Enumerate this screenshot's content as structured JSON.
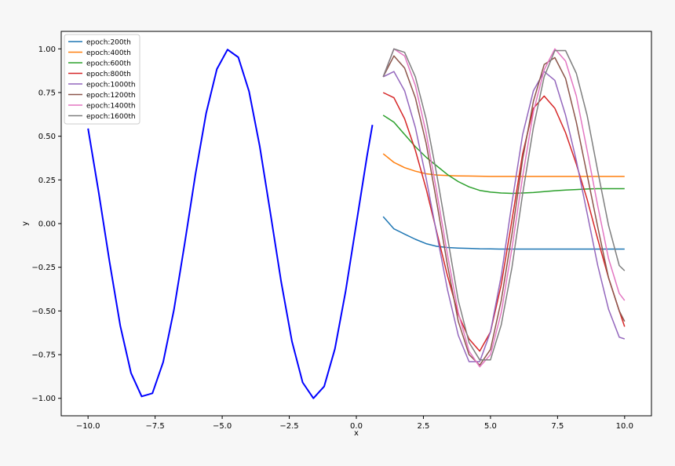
{
  "chart_data": {
    "type": "line",
    "title": "",
    "xlabel": "x",
    "ylabel": "y",
    "xlim": [
      -11.0,
      11.0
    ],
    "ylim": [
      -1.1,
      1.1
    ],
    "grid": false,
    "legend_position": "top-left",
    "x_ticks": [
      {
        "value": -10.0,
        "label": "−10.0"
      },
      {
        "value": -7.5,
        "label": "−7.5"
      },
      {
        "value": -5.0,
        "label": "−5.0"
      },
      {
        "value": -2.5,
        "label": "−2.5"
      },
      {
        "value": 0.0,
        "label": "0.0"
      },
      {
        "value": 2.5,
        "label": "2.5"
      },
      {
        "value": 5.0,
        "label": "5.0"
      },
      {
        "value": 7.5,
        "label": "7.5"
      },
      {
        "value": 10.0,
        "label": "10.0"
      }
    ],
    "y_ticks": [
      {
        "value": 1.0,
        "label": "1.00"
      },
      {
        "value": 0.75,
        "label": "0.75"
      },
      {
        "value": 0.5,
        "label": "0.50"
      },
      {
        "value": 0.25,
        "label": "0.25"
      },
      {
        "value": 0.0,
        "label": "0.00"
      },
      {
        "value": -0.25,
        "label": "−0.25"
      },
      {
        "value": -0.5,
        "label": "−0.50"
      },
      {
        "value": -0.75,
        "label": "−0.75"
      },
      {
        "value": -1.0,
        "label": "−1.00"
      }
    ],
    "x_left": [
      -10.0,
      -9.6,
      -9.2,
      -8.8,
      -8.4,
      -8.0,
      -7.6,
      -7.2,
      -6.8,
      -6.4,
      -6.0,
      -5.6,
      -5.2,
      -4.8,
      -4.4,
      -4.0,
      -3.6,
      -3.2,
      -2.8,
      -2.4,
      -2.0,
      -1.6,
      -1.2,
      -0.8,
      -0.4,
      0.0,
      0.4,
      0.6
    ],
    "x_right": [
      1.0,
      1.4,
      1.8,
      2.2,
      2.6,
      3.0,
      3.4,
      3.8,
      4.2,
      4.6,
      5.0,
      5.4,
      5.8,
      6.2,
      6.6,
      7.0,
      7.4,
      7.8,
      8.2,
      8.6,
      9.0,
      9.4,
      9.8,
      10.0
    ],
    "ground_truth": {
      "color": "#0000ff",
      "values": [
        0.544,
        0.174,
        -0.217,
        -0.584,
        -0.855,
        -0.989,
        -0.971,
        -0.793,
        -0.494,
        -0.117,
        0.279,
        0.631,
        0.884,
        0.996,
        0.952,
        0.757,
        0.443,
        0.058,
        -0.335,
        -0.675,
        -0.909,
        -1.0,
        -0.932,
        -0.717,
        -0.389,
        0.0,
        0.389,
        0.565
      ]
    },
    "series": [
      {
        "name": "epoch:200th",
        "color": "#1f77b4",
        "values": [
          0.04,
          -0.03,
          -0.06,
          -0.09,
          -0.115,
          -0.13,
          -0.137,
          -0.14,
          -0.142,
          -0.144,
          -0.145,
          -0.146,
          -0.146,
          -0.146,
          -0.146,
          -0.146,
          -0.146,
          -0.146,
          -0.146,
          -0.146,
          -0.146,
          -0.146,
          -0.146,
          -0.146
        ]
      },
      {
        "name": "epoch:400th",
        "color": "#ff7f0e",
        "values": [
          0.4,
          0.35,
          0.32,
          0.3,
          0.285,
          0.278,
          0.275,
          0.273,
          0.272,
          0.271,
          0.27,
          0.27,
          0.27,
          0.27,
          0.27,
          0.27,
          0.27,
          0.27,
          0.27,
          0.27,
          0.27,
          0.27,
          0.27,
          0.27
        ]
      },
      {
        "name": "epoch:600th",
        "color": "#2ca02c",
        "values": [
          0.62,
          0.58,
          0.51,
          0.44,
          0.38,
          0.33,
          0.28,
          0.24,
          0.21,
          0.19,
          0.18,
          0.175,
          0.173,
          0.175,
          0.178,
          0.183,
          0.188,
          0.192,
          0.195,
          0.198,
          0.2,
          0.2,
          0.2,
          0.2
        ]
      },
      {
        "name": "epoch:800th",
        "color": "#d62728",
        "values": [
          0.75,
          0.72,
          0.6,
          0.42,
          0.2,
          -0.05,
          -0.3,
          -0.52,
          -0.66,
          -0.73,
          -0.62,
          -0.35,
          0.02,
          0.4,
          0.66,
          0.73,
          0.66,
          0.52,
          0.34,
          0.14,
          -0.09,
          -0.31,
          -0.5,
          -0.59
        ]
      },
      {
        "name": "epoch:1000th",
        "color": "#9467bd",
        "values": [
          0.84,
          0.87,
          0.76,
          0.55,
          0.26,
          -0.06,
          -0.38,
          -0.64,
          -0.79,
          -0.79,
          -0.62,
          -0.3,
          0.12,
          0.51,
          0.76,
          0.87,
          0.82,
          0.62,
          0.36,
          0.06,
          -0.24,
          -0.49,
          -0.65,
          -0.66
        ]
      },
      {
        "name": "epoch:1200th",
        "color": "#8c564b",
        "values": [
          0.84,
          0.96,
          0.89,
          0.72,
          0.46,
          0.12,
          -0.24,
          -0.56,
          -0.75,
          -0.81,
          -0.72,
          -0.44,
          -0.06,
          0.37,
          0.7,
          0.91,
          0.95,
          0.83,
          0.58,
          0.28,
          -0.02,
          -0.31,
          -0.5,
          -0.56
        ]
      },
      {
        "name": "epoch:1400th",
        "color": "#e377c2",
        "values": [
          0.84,
          1.0,
          0.96,
          0.79,
          0.52,
          0.18,
          -0.18,
          -0.51,
          -0.73,
          -0.82,
          -0.75,
          -0.51,
          -0.14,
          0.27,
          0.64,
          0.88,
          1.0,
          0.93,
          0.73,
          0.42,
          0.1,
          -0.2,
          -0.4,
          -0.44
        ]
      },
      {
        "name": "epoch:1600th",
        "color": "#7f7f7f",
        "values": [
          0.84,
          1.0,
          0.98,
          0.84,
          0.6,
          0.28,
          -0.08,
          -0.44,
          -0.68,
          -0.78,
          -0.78,
          -0.58,
          -0.25,
          0.17,
          0.55,
          0.84,
          0.99,
          0.99,
          0.86,
          0.62,
          0.3,
          -0.01,
          -0.24,
          -0.27
        ]
      }
    ]
  }
}
